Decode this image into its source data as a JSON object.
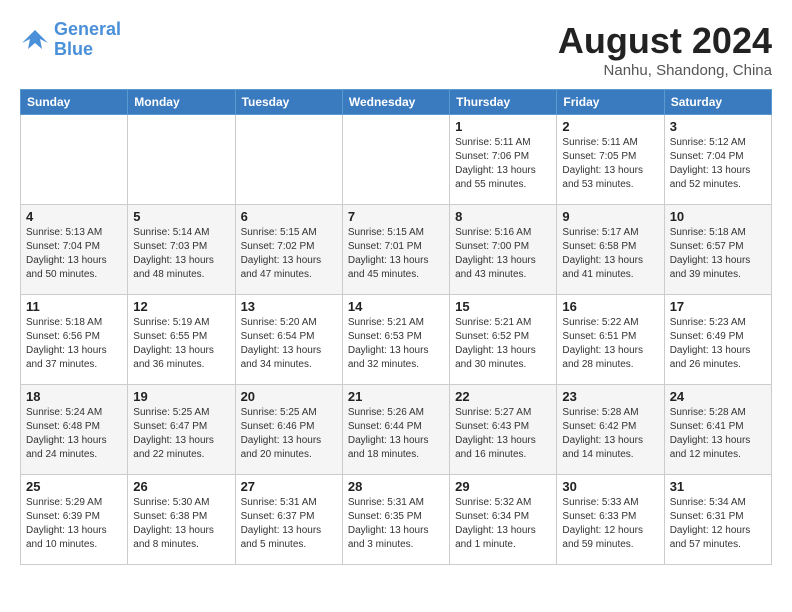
{
  "logo": {
    "line1": "General",
    "line2": "Blue"
  },
  "title": "August 2024",
  "location": "Nanhu, Shandong, China",
  "days_of_week": [
    "Sunday",
    "Monday",
    "Tuesday",
    "Wednesday",
    "Thursday",
    "Friday",
    "Saturday"
  ],
  "weeks": [
    [
      {
        "day": "",
        "info": ""
      },
      {
        "day": "",
        "info": ""
      },
      {
        "day": "",
        "info": ""
      },
      {
        "day": "",
        "info": ""
      },
      {
        "day": "1",
        "info": "Sunrise: 5:11 AM\nSunset: 7:06 PM\nDaylight: 13 hours\nand 55 minutes."
      },
      {
        "day": "2",
        "info": "Sunrise: 5:11 AM\nSunset: 7:05 PM\nDaylight: 13 hours\nand 53 minutes."
      },
      {
        "day": "3",
        "info": "Sunrise: 5:12 AM\nSunset: 7:04 PM\nDaylight: 13 hours\nand 52 minutes."
      }
    ],
    [
      {
        "day": "4",
        "info": "Sunrise: 5:13 AM\nSunset: 7:04 PM\nDaylight: 13 hours\nand 50 minutes."
      },
      {
        "day": "5",
        "info": "Sunrise: 5:14 AM\nSunset: 7:03 PM\nDaylight: 13 hours\nand 48 minutes."
      },
      {
        "day": "6",
        "info": "Sunrise: 5:15 AM\nSunset: 7:02 PM\nDaylight: 13 hours\nand 47 minutes."
      },
      {
        "day": "7",
        "info": "Sunrise: 5:15 AM\nSunset: 7:01 PM\nDaylight: 13 hours\nand 45 minutes."
      },
      {
        "day": "8",
        "info": "Sunrise: 5:16 AM\nSunset: 7:00 PM\nDaylight: 13 hours\nand 43 minutes."
      },
      {
        "day": "9",
        "info": "Sunrise: 5:17 AM\nSunset: 6:58 PM\nDaylight: 13 hours\nand 41 minutes."
      },
      {
        "day": "10",
        "info": "Sunrise: 5:18 AM\nSunset: 6:57 PM\nDaylight: 13 hours\nand 39 minutes."
      }
    ],
    [
      {
        "day": "11",
        "info": "Sunrise: 5:18 AM\nSunset: 6:56 PM\nDaylight: 13 hours\nand 37 minutes."
      },
      {
        "day": "12",
        "info": "Sunrise: 5:19 AM\nSunset: 6:55 PM\nDaylight: 13 hours\nand 36 minutes."
      },
      {
        "day": "13",
        "info": "Sunrise: 5:20 AM\nSunset: 6:54 PM\nDaylight: 13 hours\nand 34 minutes."
      },
      {
        "day": "14",
        "info": "Sunrise: 5:21 AM\nSunset: 6:53 PM\nDaylight: 13 hours\nand 32 minutes."
      },
      {
        "day": "15",
        "info": "Sunrise: 5:21 AM\nSunset: 6:52 PM\nDaylight: 13 hours\nand 30 minutes."
      },
      {
        "day": "16",
        "info": "Sunrise: 5:22 AM\nSunset: 6:51 PM\nDaylight: 13 hours\nand 28 minutes."
      },
      {
        "day": "17",
        "info": "Sunrise: 5:23 AM\nSunset: 6:49 PM\nDaylight: 13 hours\nand 26 minutes."
      }
    ],
    [
      {
        "day": "18",
        "info": "Sunrise: 5:24 AM\nSunset: 6:48 PM\nDaylight: 13 hours\nand 24 minutes."
      },
      {
        "day": "19",
        "info": "Sunrise: 5:25 AM\nSunset: 6:47 PM\nDaylight: 13 hours\nand 22 minutes."
      },
      {
        "day": "20",
        "info": "Sunrise: 5:25 AM\nSunset: 6:46 PM\nDaylight: 13 hours\nand 20 minutes."
      },
      {
        "day": "21",
        "info": "Sunrise: 5:26 AM\nSunset: 6:44 PM\nDaylight: 13 hours\nand 18 minutes."
      },
      {
        "day": "22",
        "info": "Sunrise: 5:27 AM\nSunset: 6:43 PM\nDaylight: 13 hours\nand 16 minutes."
      },
      {
        "day": "23",
        "info": "Sunrise: 5:28 AM\nSunset: 6:42 PM\nDaylight: 13 hours\nand 14 minutes."
      },
      {
        "day": "24",
        "info": "Sunrise: 5:28 AM\nSunset: 6:41 PM\nDaylight: 13 hours\nand 12 minutes."
      }
    ],
    [
      {
        "day": "25",
        "info": "Sunrise: 5:29 AM\nSunset: 6:39 PM\nDaylight: 13 hours\nand 10 minutes."
      },
      {
        "day": "26",
        "info": "Sunrise: 5:30 AM\nSunset: 6:38 PM\nDaylight: 13 hours\nand 8 minutes."
      },
      {
        "day": "27",
        "info": "Sunrise: 5:31 AM\nSunset: 6:37 PM\nDaylight: 13 hours\nand 5 minutes."
      },
      {
        "day": "28",
        "info": "Sunrise: 5:31 AM\nSunset: 6:35 PM\nDaylight: 13 hours\nand 3 minutes."
      },
      {
        "day": "29",
        "info": "Sunrise: 5:32 AM\nSunset: 6:34 PM\nDaylight: 13 hours\nand 1 minute."
      },
      {
        "day": "30",
        "info": "Sunrise: 5:33 AM\nSunset: 6:33 PM\nDaylight: 12 hours\nand 59 minutes."
      },
      {
        "day": "31",
        "info": "Sunrise: 5:34 AM\nSunset: 6:31 PM\nDaylight: 12 hours\nand 57 minutes."
      }
    ]
  ]
}
